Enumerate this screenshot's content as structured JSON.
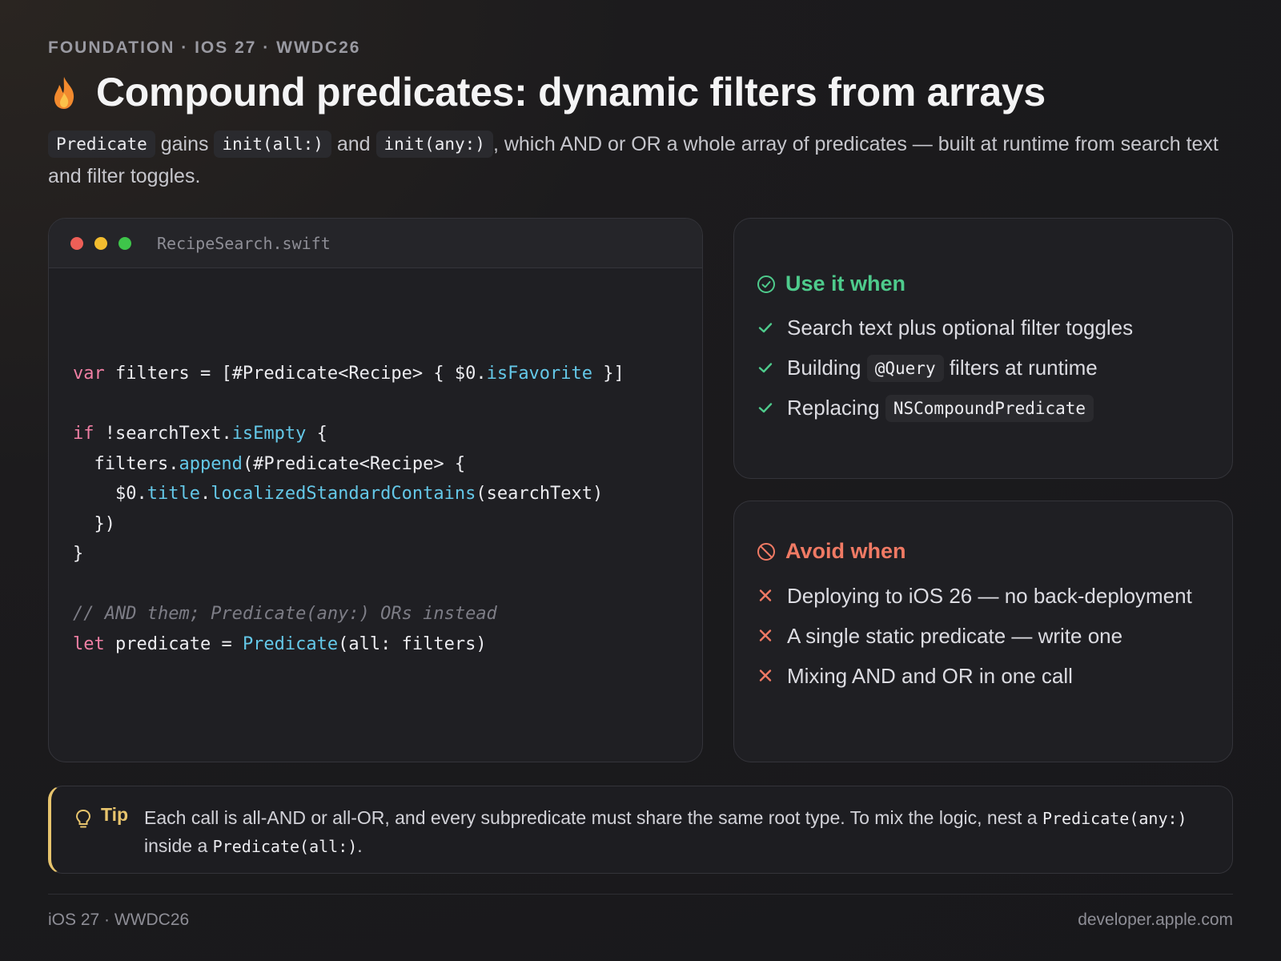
{
  "eyebrow": "FOUNDATION · IOS 27 · WWDC26",
  "title": "Compound predicates: dynamic filters from arrays",
  "subtitle": {
    "code1": "Predicate",
    "t1": " gains ",
    "code2": "init(all:)",
    "t2": " and ",
    "code3": "init(any:)",
    "t3": ", which AND or OR a whole array of predicates — built at runtime from search text and filter toggles."
  },
  "code_card": {
    "filename": "RecipeSearch.swift",
    "window_dots": [
      "#ee5f57",
      "#f3bd2f",
      "#3ec54a"
    ],
    "lines": {
      "l1": {
        "kw": "var",
        "a": " filters = [#Predicate<Recipe> { $0.",
        "fn": "isFavorite",
        "b": " }]"
      },
      "l3": {
        "kw": "if",
        "a": " !searchText.",
        "fn": "isEmpty",
        "b": " {"
      },
      "l4": {
        "a": "  filters.",
        "fn": "append",
        "b": "(#Predicate<Recipe> {"
      },
      "l5": {
        "a": "    $0.",
        "fn1": "title",
        "dot": ".",
        "fn2": "localizedStandardContains",
        "b": "(searchText)"
      },
      "l6": "  })",
      "l7": "}",
      "l9": "// AND them; Predicate(any:) ORs instead",
      "l10": {
        "kw": "let",
        "a": " predicate = ",
        "fn": "Predicate",
        "b": "(all: filters)"
      }
    }
  },
  "use_card": {
    "heading": "Use it when",
    "color": "#4ecb8c",
    "items": [
      {
        "text": "Search text plus optional filter toggles"
      },
      {
        "pre": "Building ",
        "code": "@Query",
        "post": " filters at runtime"
      },
      {
        "pre": "Replacing ",
        "code": "NSCompoundPredicate"
      }
    ]
  },
  "avoid_card": {
    "heading": "Avoid when",
    "color": "#f07a64",
    "items": [
      "Deploying to iOS 26 — no back-deployment",
      "A single static predicate — write one",
      "Mixing AND and OR in one call"
    ]
  },
  "tip": {
    "label": "Tip",
    "t1": "Each call is all-AND or all-OR, and every subpredicate must share the same root type. To mix the logic, nest a ",
    "code1": "Predicate(any:)",
    "t2": " inside a ",
    "code2": "Predicate(all:)",
    "t3": "."
  },
  "footer": {
    "left": "iOS 27 · WWDC26",
    "right": "developer.apple.com"
  }
}
